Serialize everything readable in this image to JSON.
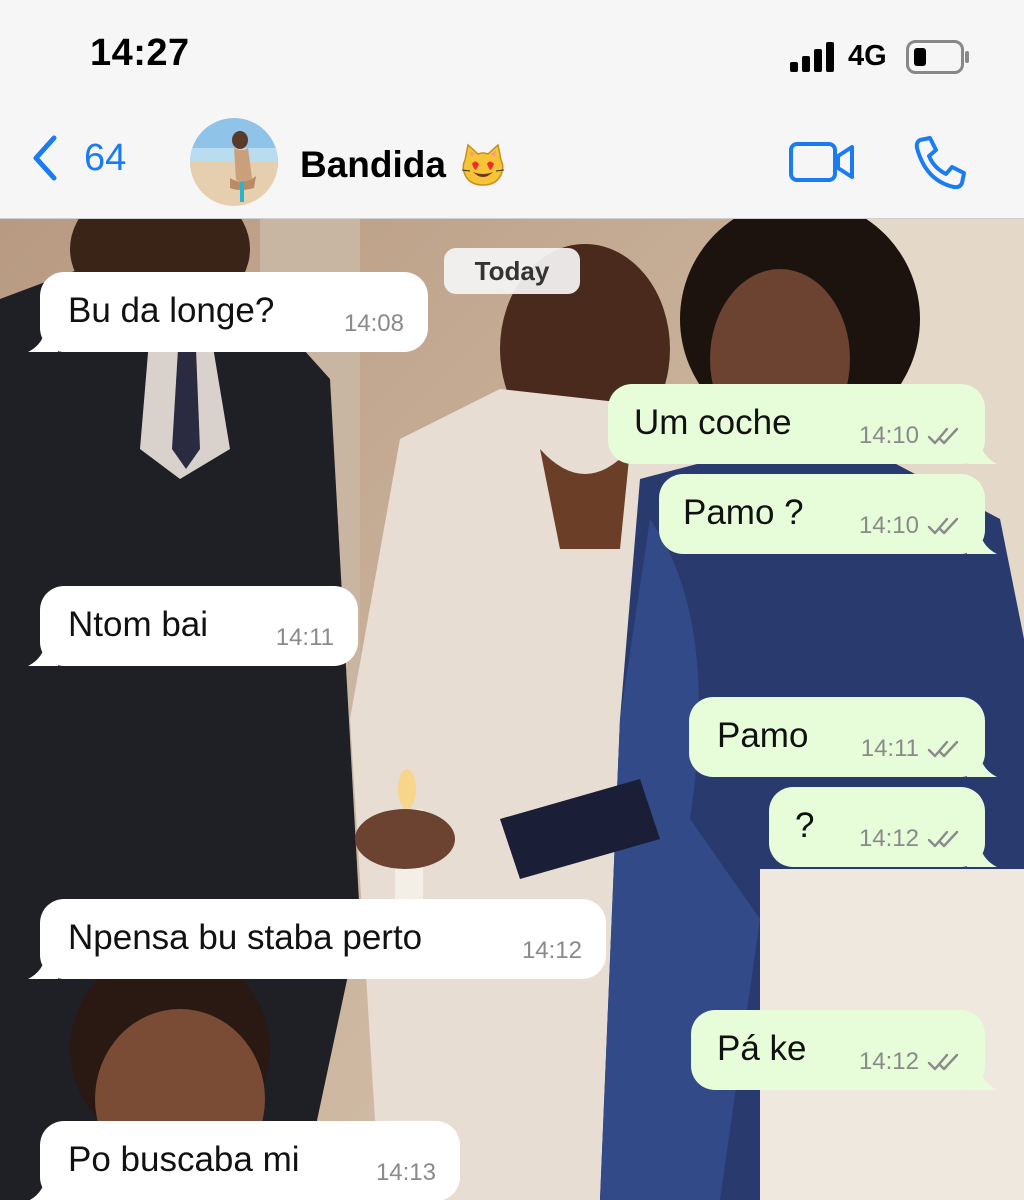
{
  "status_bar": {
    "time": "14:27",
    "network": "4G"
  },
  "header": {
    "back_count": "64",
    "contact_name": "Bandida"
  },
  "chat": {
    "date_separator": "Today",
    "messages": [
      {
        "dir": "in",
        "text": "Bu da longe?",
        "time": "14:08"
      },
      {
        "dir": "out",
        "text": "Um coche",
        "time": "14:10"
      },
      {
        "dir": "out",
        "text": "Pamo ?",
        "time": "14:10"
      },
      {
        "dir": "in",
        "text": "Ntom bai",
        "time": "14:11"
      },
      {
        "dir": "out",
        "text": "Pamo",
        "time": "14:11"
      },
      {
        "dir": "out",
        "text": "?",
        "time": "14:12"
      },
      {
        "dir": "in",
        "text": "Npensa bu staba perto",
        "time": "14:12"
      },
      {
        "dir": "out",
        "text": "Pá ke",
        "time": "14:12"
      },
      {
        "dir": "in",
        "text": "Po buscaba mi",
        "time": "14:13"
      }
    ]
  },
  "colors": {
    "accent": "#1a7cf2",
    "incoming_bubble": "#ffffff",
    "outgoing_bubble": "#e7fcd9",
    "timestamp": "#8a8a8a"
  },
  "icons": {
    "back": "chevron-left-icon",
    "contact_emoji": "heart-eyes-cat-emoji",
    "video": "video-camera-icon",
    "voice": "phone-icon",
    "read": "double-check-icon"
  }
}
